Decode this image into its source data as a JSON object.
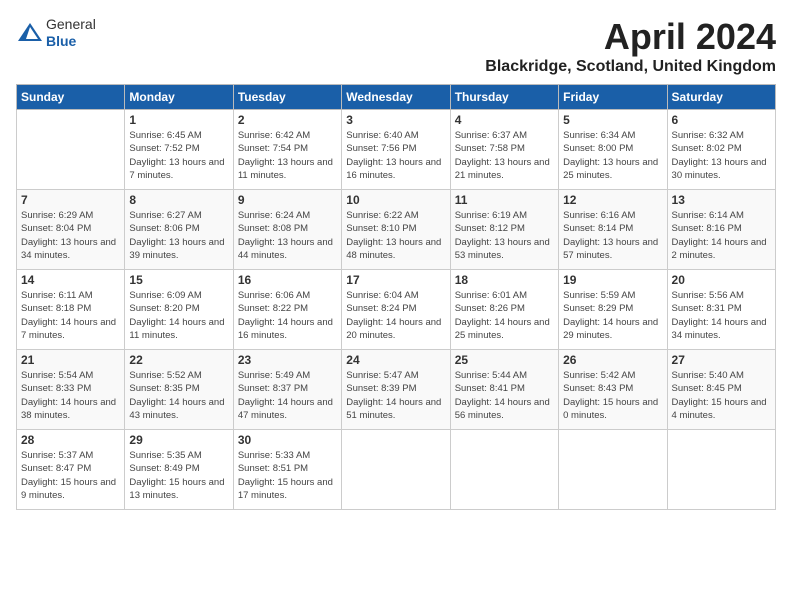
{
  "header": {
    "logo_line1": "General",
    "logo_line2": "Blue",
    "month": "April 2024",
    "location": "Blackridge, Scotland, United Kingdom"
  },
  "weekdays": [
    "Sunday",
    "Monday",
    "Tuesday",
    "Wednesday",
    "Thursday",
    "Friday",
    "Saturday"
  ],
  "weeks": [
    [
      {
        "day": "",
        "sunrise": "",
        "sunset": "",
        "daylight": ""
      },
      {
        "day": "1",
        "sunrise": "Sunrise: 6:45 AM",
        "sunset": "Sunset: 7:52 PM",
        "daylight": "Daylight: 13 hours and 7 minutes."
      },
      {
        "day": "2",
        "sunrise": "Sunrise: 6:42 AM",
        "sunset": "Sunset: 7:54 PM",
        "daylight": "Daylight: 13 hours and 11 minutes."
      },
      {
        "day": "3",
        "sunrise": "Sunrise: 6:40 AM",
        "sunset": "Sunset: 7:56 PM",
        "daylight": "Daylight: 13 hours and 16 minutes."
      },
      {
        "day": "4",
        "sunrise": "Sunrise: 6:37 AM",
        "sunset": "Sunset: 7:58 PM",
        "daylight": "Daylight: 13 hours and 21 minutes."
      },
      {
        "day": "5",
        "sunrise": "Sunrise: 6:34 AM",
        "sunset": "Sunset: 8:00 PM",
        "daylight": "Daylight: 13 hours and 25 minutes."
      },
      {
        "day": "6",
        "sunrise": "Sunrise: 6:32 AM",
        "sunset": "Sunset: 8:02 PM",
        "daylight": "Daylight: 13 hours and 30 minutes."
      }
    ],
    [
      {
        "day": "7",
        "sunrise": "Sunrise: 6:29 AM",
        "sunset": "Sunset: 8:04 PM",
        "daylight": "Daylight: 13 hours and 34 minutes."
      },
      {
        "day": "8",
        "sunrise": "Sunrise: 6:27 AM",
        "sunset": "Sunset: 8:06 PM",
        "daylight": "Daylight: 13 hours and 39 minutes."
      },
      {
        "day": "9",
        "sunrise": "Sunrise: 6:24 AM",
        "sunset": "Sunset: 8:08 PM",
        "daylight": "Daylight: 13 hours and 44 minutes."
      },
      {
        "day": "10",
        "sunrise": "Sunrise: 6:22 AM",
        "sunset": "Sunset: 8:10 PM",
        "daylight": "Daylight: 13 hours and 48 minutes."
      },
      {
        "day": "11",
        "sunrise": "Sunrise: 6:19 AM",
        "sunset": "Sunset: 8:12 PM",
        "daylight": "Daylight: 13 hours and 53 minutes."
      },
      {
        "day": "12",
        "sunrise": "Sunrise: 6:16 AM",
        "sunset": "Sunset: 8:14 PM",
        "daylight": "Daylight: 13 hours and 57 minutes."
      },
      {
        "day": "13",
        "sunrise": "Sunrise: 6:14 AM",
        "sunset": "Sunset: 8:16 PM",
        "daylight": "Daylight: 14 hours and 2 minutes."
      }
    ],
    [
      {
        "day": "14",
        "sunrise": "Sunrise: 6:11 AM",
        "sunset": "Sunset: 8:18 PM",
        "daylight": "Daylight: 14 hours and 7 minutes."
      },
      {
        "day": "15",
        "sunrise": "Sunrise: 6:09 AM",
        "sunset": "Sunset: 8:20 PM",
        "daylight": "Daylight: 14 hours and 11 minutes."
      },
      {
        "day": "16",
        "sunrise": "Sunrise: 6:06 AM",
        "sunset": "Sunset: 8:22 PM",
        "daylight": "Daylight: 14 hours and 16 minutes."
      },
      {
        "day": "17",
        "sunrise": "Sunrise: 6:04 AM",
        "sunset": "Sunset: 8:24 PM",
        "daylight": "Daylight: 14 hours and 20 minutes."
      },
      {
        "day": "18",
        "sunrise": "Sunrise: 6:01 AM",
        "sunset": "Sunset: 8:26 PM",
        "daylight": "Daylight: 14 hours and 25 minutes."
      },
      {
        "day": "19",
        "sunrise": "Sunrise: 5:59 AM",
        "sunset": "Sunset: 8:29 PM",
        "daylight": "Daylight: 14 hours and 29 minutes."
      },
      {
        "day": "20",
        "sunrise": "Sunrise: 5:56 AM",
        "sunset": "Sunset: 8:31 PM",
        "daylight": "Daylight: 14 hours and 34 minutes."
      }
    ],
    [
      {
        "day": "21",
        "sunrise": "Sunrise: 5:54 AM",
        "sunset": "Sunset: 8:33 PM",
        "daylight": "Daylight: 14 hours and 38 minutes."
      },
      {
        "day": "22",
        "sunrise": "Sunrise: 5:52 AM",
        "sunset": "Sunset: 8:35 PM",
        "daylight": "Daylight: 14 hours and 43 minutes."
      },
      {
        "day": "23",
        "sunrise": "Sunrise: 5:49 AM",
        "sunset": "Sunset: 8:37 PM",
        "daylight": "Daylight: 14 hours and 47 minutes."
      },
      {
        "day": "24",
        "sunrise": "Sunrise: 5:47 AM",
        "sunset": "Sunset: 8:39 PM",
        "daylight": "Daylight: 14 hours and 51 minutes."
      },
      {
        "day": "25",
        "sunrise": "Sunrise: 5:44 AM",
        "sunset": "Sunset: 8:41 PM",
        "daylight": "Daylight: 14 hours and 56 minutes."
      },
      {
        "day": "26",
        "sunrise": "Sunrise: 5:42 AM",
        "sunset": "Sunset: 8:43 PM",
        "daylight": "Daylight: 15 hours and 0 minutes."
      },
      {
        "day": "27",
        "sunrise": "Sunrise: 5:40 AM",
        "sunset": "Sunset: 8:45 PM",
        "daylight": "Daylight: 15 hours and 4 minutes."
      }
    ],
    [
      {
        "day": "28",
        "sunrise": "Sunrise: 5:37 AM",
        "sunset": "Sunset: 8:47 PM",
        "daylight": "Daylight: 15 hours and 9 minutes."
      },
      {
        "day": "29",
        "sunrise": "Sunrise: 5:35 AM",
        "sunset": "Sunset: 8:49 PM",
        "daylight": "Daylight: 15 hours and 13 minutes."
      },
      {
        "day": "30",
        "sunrise": "Sunrise: 5:33 AM",
        "sunset": "Sunset: 8:51 PM",
        "daylight": "Daylight: 15 hours and 17 minutes."
      },
      {
        "day": "",
        "sunrise": "",
        "sunset": "",
        "daylight": ""
      },
      {
        "day": "",
        "sunrise": "",
        "sunset": "",
        "daylight": ""
      },
      {
        "day": "",
        "sunrise": "",
        "sunset": "",
        "daylight": ""
      },
      {
        "day": "",
        "sunrise": "",
        "sunset": "",
        "daylight": ""
      }
    ]
  ]
}
